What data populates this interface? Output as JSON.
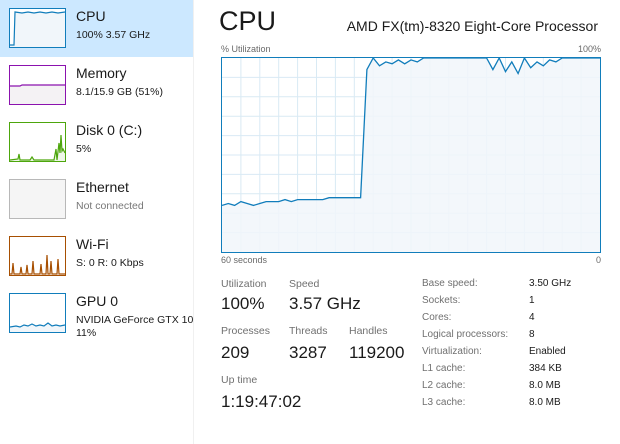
{
  "sidebar": {
    "items": [
      {
        "title": "CPU",
        "subtitle": "100% 3.57 GHz",
        "color": "#117dbb",
        "selected": true,
        "muted": false
      },
      {
        "title": "Memory",
        "subtitle": "8.1/15.9 GB (51%)",
        "color": "#8b12ae",
        "selected": false,
        "muted": false
      },
      {
        "title": "Disk 0 (C:)",
        "subtitle": "5%",
        "color": "#4da60c",
        "selected": false,
        "muted": false
      },
      {
        "title": "Ethernet",
        "subtitle": "Not connected",
        "color": "#a0a0a0",
        "selected": false,
        "muted": true
      },
      {
        "title": "Wi-Fi",
        "subtitle": "S: 0 R: 0 Kbps",
        "color": "#a74f01",
        "selected": false,
        "muted": false
      },
      {
        "title": "GPU 0",
        "subtitle": "NVIDIA GeForce GTX 10",
        "subtitle2": "11%",
        "color": "#117dbb",
        "selected": false,
        "muted": false
      }
    ]
  },
  "header": {
    "title": "CPU",
    "processor": "AMD FX(tm)-8320 Eight-Core Processor"
  },
  "graph": {
    "y_label": "% Utilization",
    "y_max_label": "100%",
    "x_left_label": "60 seconds",
    "x_right_label": "0",
    "line_color": "#117dbb",
    "fill_color": "#f1f6fa",
    "grid_color": "#d9eaf4"
  },
  "chart_data": {
    "type": "area",
    "ylabel": "% Utilization",
    "ylim": [
      0,
      100
    ],
    "x": [
      60,
      59,
      58,
      57,
      56,
      55,
      54,
      53,
      52,
      51,
      50,
      49,
      48,
      47,
      46,
      45,
      44,
      43,
      42,
      41,
      40,
      39,
      38,
      37,
      36,
      35,
      34,
      33,
      32,
      31,
      30,
      29,
      28,
      27,
      26,
      25,
      24,
      23,
      22,
      21,
      20,
      19,
      18,
      17,
      16,
      15,
      14,
      13,
      12,
      11,
      10,
      9,
      8,
      7,
      6,
      5,
      4,
      3,
      2,
      1,
      0
    ],
    "series": [
      {
        "values": [
          24,
          25,
          24,
          26,
          25,
          24,
          25,
          26,
          26,
          26,
          27,
          26,
          27,
          27,
          27,
          27,
          27,
          28,
          28,
          28,
          28,
          28,
          28,
          94,
          100,
          96,
          98,
          97,
          99,
          97,
          99,
          98,
          100,
          100,
          100,
          100,
          100,
          100,
          100,
          100,
          100,
          100,
          100,
          94,
          100,
          93,
          98,
          92,
          100,
          95,
          98,
          96,
          99,
          98,
          100,
          100,
          100,
          100,
          100,
          100,
          100
        ]
      }
    ]
  },
  "stats": {
    "utilization": {
      "label": "Utilization",
      "value": "100%"
    },
    "speed": {
      "label": "Speed",
      "value": "3.57 GHz"
    },
    "processes": {
      "label": "Processes",
      "value": "209"
    },
    "threads": {
      "label": "Threads",
      "value": "3287"
    },
    "handles": {
      "label": "Handles",
      "value": "119200"
    },
    "uptime": {
      "label": "Up time",
      "value": "1:19:47:02"
    }
  },
  "specs": [
    {
      "label": "Base speed:",
      "value": "3.50 GHz"
    },
    {
      "label": "Sockets:",
      "value": "1"
    },
    {
      "label": "Cores:",
      "value": "4"
    },
    {
      "label": "Logical processors:",
      "value": "8"
    },
    {
      "label": "Virtualization:",
      "value": "Enabled"
    },
    {
      "label": "L1 cache:",
      "value": "384 KB"
    },
    {
      "label": "L2 cache:",
      "value": "8.0 MB"
    },
    {
      "label": "L3 cache:",
      "value": "8.0 MB"
    }
  ]
}
